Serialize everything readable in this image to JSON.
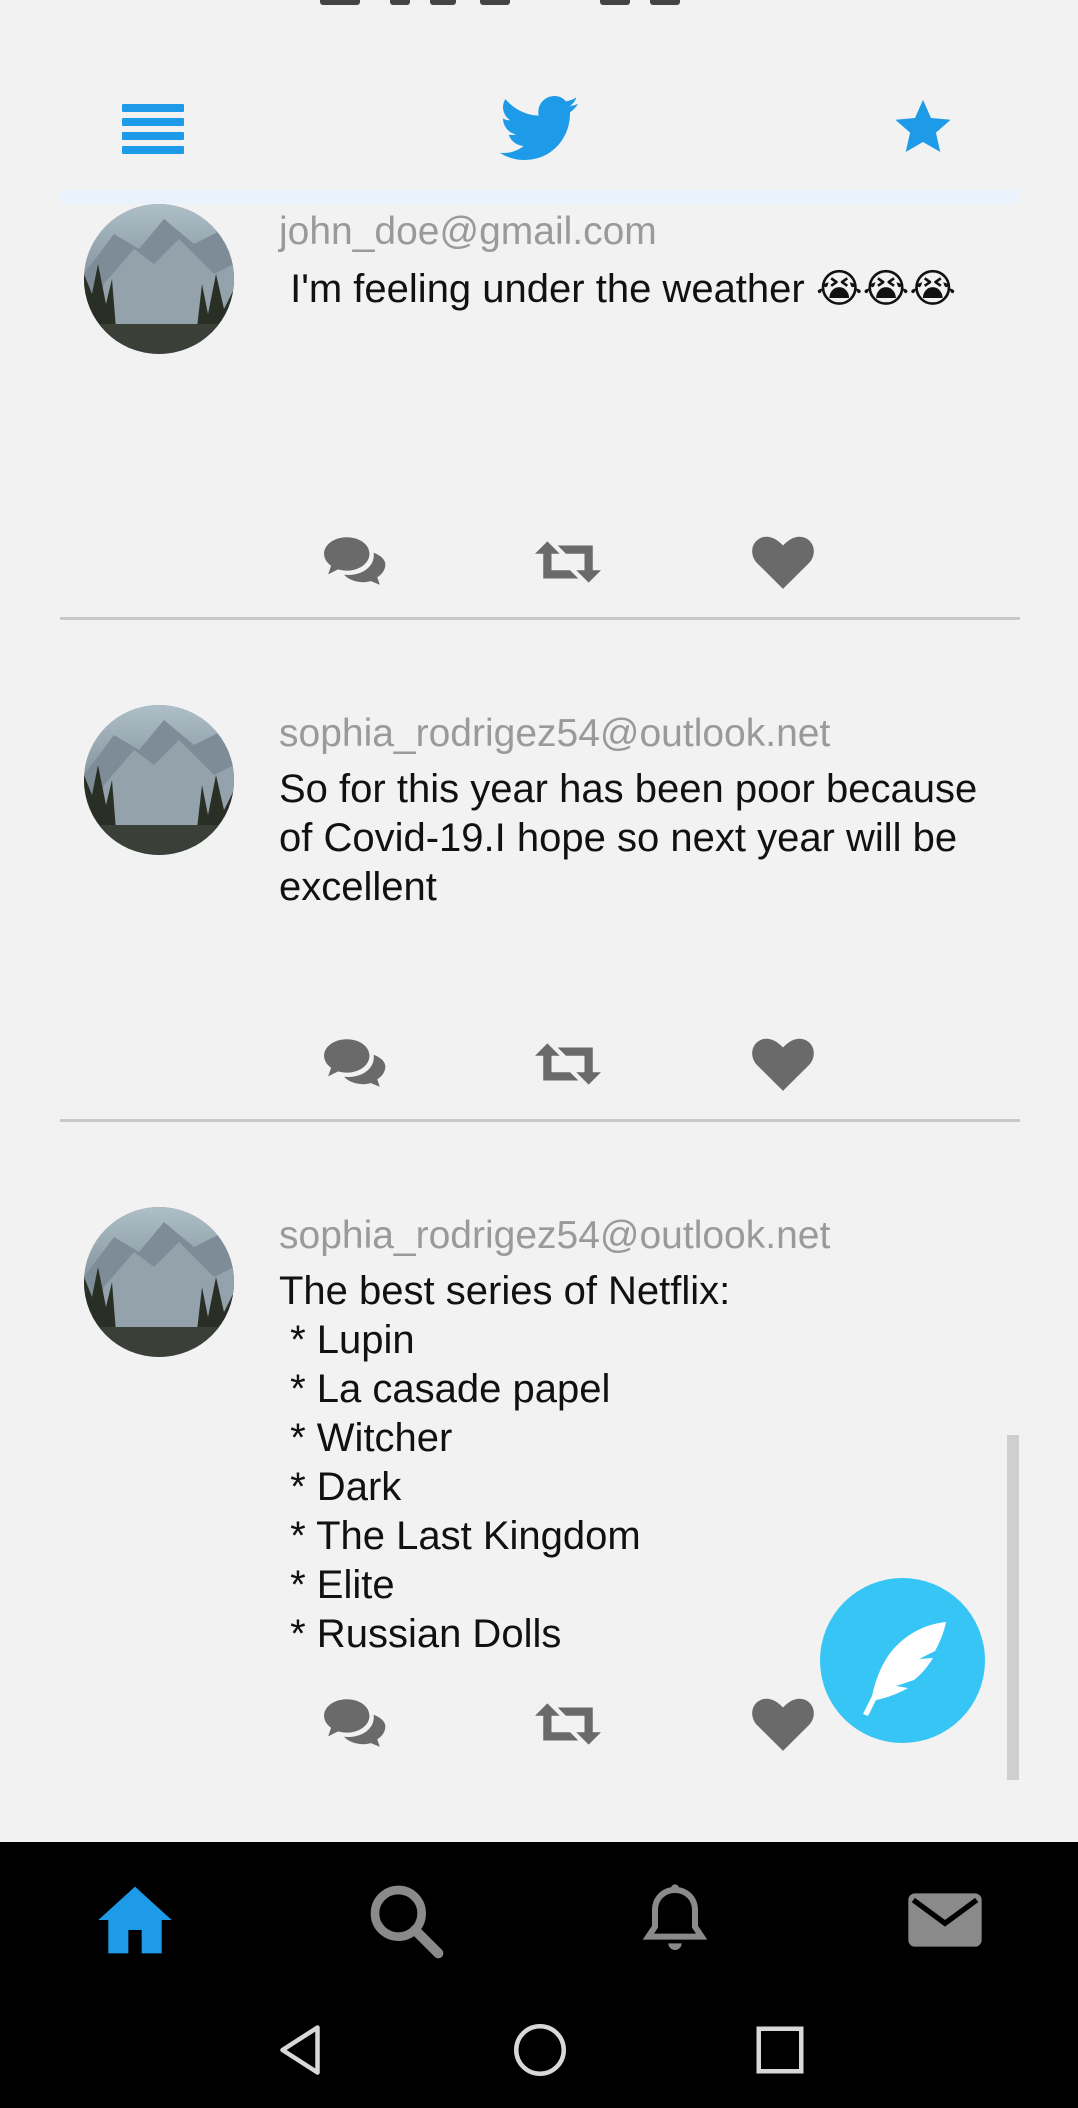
{
  "topbar": {
    "menu_icon": "hamburger-menu-icon",
    "logo_icon": "twitter-bird-icon",
    "favorites_icon": "star-icon",
    "accent_color": "#1e9be8"
  },
  "tweets": [
    {
      "email": "john_doe@gmail.com",
      "text": " I'm feeling under the weather 😭😭😭"
    },
    {
      "email": "sophia_rodrigez54@outlook.net",
      "text": "So for this year has been poor because of Covid-19.I hope so next year will be excellent"
    },
    {
      "email": "sophia_rodrigez54@outlook.net",
      "text": "The best series of Netflix:\n * Lupin\n * La casade papel\n * Witcher\n * Dark\n * The Last Kingdom\n * Elite\n * Russian Dolls"
    }
  ],
  "tweet_actions": [
    "comment-icon",
    "retweet-icon",
    "like-icon"
  ],
  "fab": {
    "icon": "feather-compose-icon",
    "color": "#36c5f4"
  },
  "bottom_nav": {
    "items": [
      "home-icon",
      "search-icon",
      "notifications-bell-icon",
      "mail-icon"
    ],
    "active": "home-icon",
    "active_color": "#1e9be8"
  },
  "system_nav": [
    "back-icon",
    "home-circle-icon",
    "recents-icon"
  ]
}
